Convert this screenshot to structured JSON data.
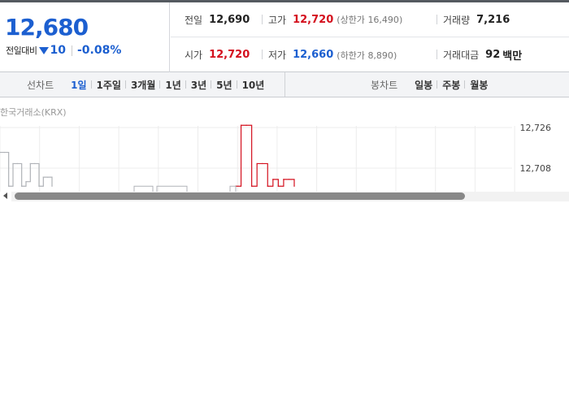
{
  "quote": {
    "price": "12,680",
    "change_label": "전일대비",
    "direction_icon": "down-triangle-icon",
    "change": "10",
    "change_pct": "-0.08%"
  },
  "stats": {
    "prev_close": {
      "label": "전일",
      "value": "12,690"
    },
    "high": {
      "label": "고가",
      "value": "12,720",
      "sub_label": "상한가",
      "sub_value": "16,490"
    },
    "volume": {
      "label": "거래량",
      "value": "7,216"
    },
    "open": {
      "label": "시가",
      "value": "12,720"
    },
    "low": {
      "label": "저가",
      "value": "12,660",
      "sub_label": "하한가",
      "sub_value": "8,890"
    },
    "amount": {
      "label": "거래대금",
      "value": "92",
      "unit": "백만"
    }
  },
  "tabs": {
    "line_chart_label": "선차트",
    "line_periods": [
      "1일",
      "1주일",
      "3개월",
      "1년",
      "3년",
      "5년",
      "10년"
    ],
    "active_period": "1일",
    "candle_chart_label": "봉차트",
    "candle_periods": [
      "일봉",
      "주봉",
      "월봉"
    ]
  },
  "chart": {
    "source": "한국거래소(KRX)",
    "y_ticks": [
      "12,726",
      "12,708"
    ],
    "colors": {
      "up": "#d4101e",
      "flat": "#b0b3b8",
      "grid": "#ececec"
    }
  },
  "chart_data": {
    "type": "line",
    "title": "",
    "xlabel": "",
    "ylabel": "",
    "ylim": [
      12690,
      12726
    ],
    "y_ticks": [
      12726,
      12708
    ],
    "grid": true,
    "series": [
      {
        "color": "#b0b3b8",
        "values": [
          12715,
          12715,
          12700,
          12710,
          12710,
          12700,
          12702,
          12710,
          12710,
          12700,
          12704,
          12704,
          12700
        ]
      },
      {
        "color": "#d4101e",
        "values": [
          12700,
          12727,
          12727,
          12700,
          12710,
          12710,
          12700,
          12703,
          12700,
          12703,
          12703,
          12700
        ]
      }
    ]
  }
}
